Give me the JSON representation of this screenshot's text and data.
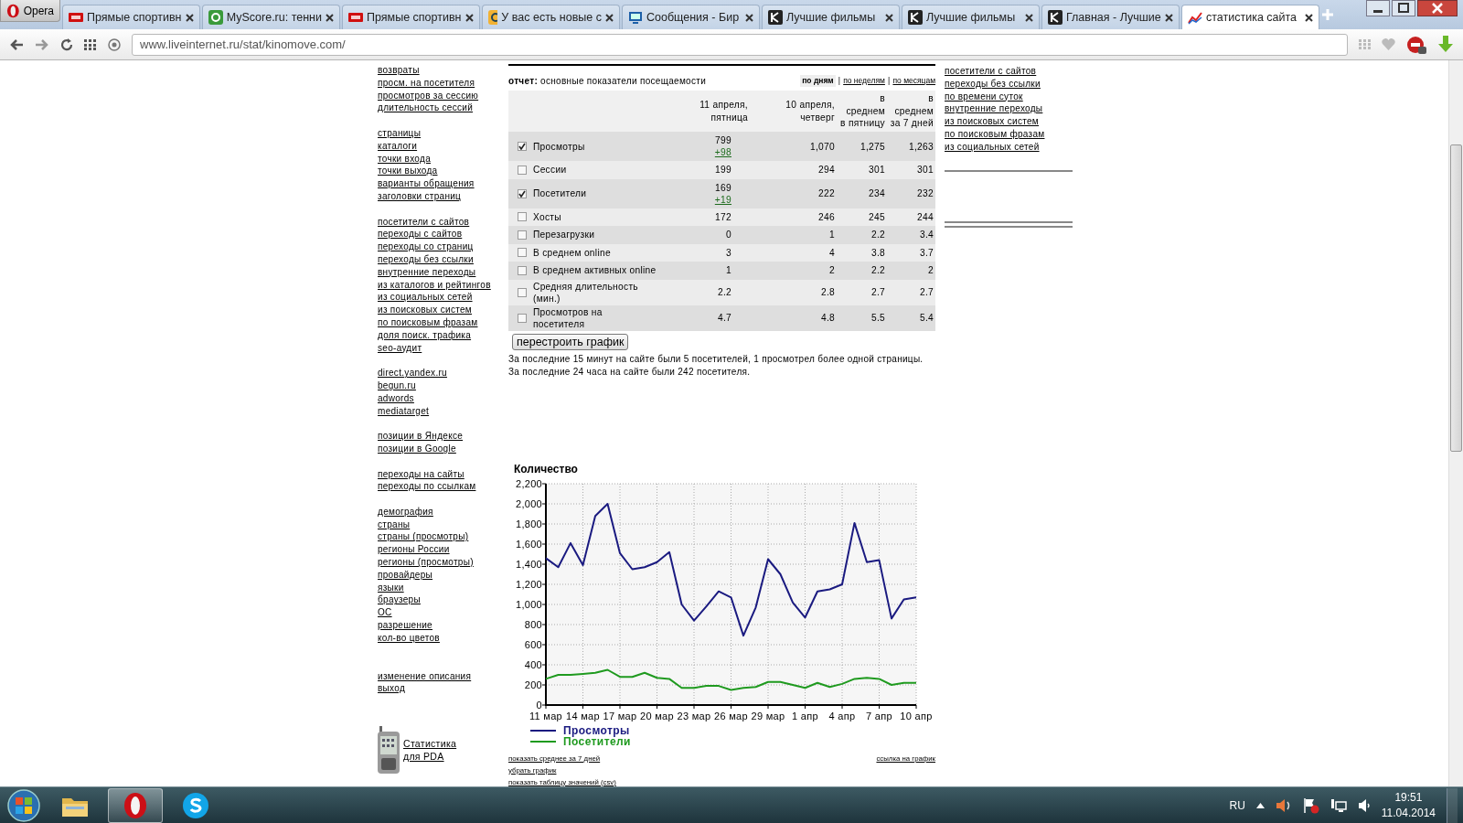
{
  "browser": {
    "menu_label": "Opera",
    "tabs": [
      {
        "label": "Прямые спортивн",
        "selected": false
      },
      {
        "label": "MyScore.ru: тенни",
        "selected": false
      },
      {
        "label": "Прямые спортивн",
        "selected": false
      },
      {
        "label": "У вас есть новые с",
        "selected": false
      },
      {
        "label": "Сообщения - Бир",
        "selected": false
      },
      {
        "label": "Лучшие фильмы",
        "selected": false
      },
      {
        "label": "Лучшие фильмы",
        "selected": false
      },
      {
        "label": "Главная - Лучшие",
        "selected": false
      },
      {
        "label": "статистика сайта",
        "selected": true
      }
    ],
    "address": "www.liveinternet.ru/stat/kinomove.com/"
  },
  "sidebar": {
    "groups": [
      [
        "возвраты",
        "просм. на посетителя",
        "просмотров за сессию",
        "длительность сессий"
      ],
      [
        "страницы",
        "каталоги",
        "точки входа",
        "точки выхода",
        "варианты обращения",
        "заголовки страниц"
      ],
      [
        "посетители с сайтов",
        "переходы с сайтов",
        "переходы со страниц",
        "переходы без ссылки",
        "внутренние переходы",
        "из каталогов и рейтингов",
        "из социальных сетей",
        "из поисковых систем",
        "по поисковым фразам",
        "доля поиск. трафика",
        "seo-аудит"
      ],
      [
        "direct.yandex.ru",
        "begun.ru",
        "adwords",
        "mediatarget"
      ],
      [
        "позиции в Яндексе",
        "позиции в Google"
      ],
      [
        "переходы на сайты",
        "переходы по ссылкам"
      ],
      [
        "демография",
        "страны",
        "страны (просмотры)",
        "регионы России",
        "регионы (просмотры)",
        "провайдеры",
        "языки",
        "браузеры",
        "ОС",
        "разрешение",
        "кол-во цветов"
      ],
      [
        "изменение описания",
        "выход"
      ]
    ],
    "pda_link": "Статистика для PDA"
  },
  "report": {
    "label": "отчет:",
    "title": "основные показатели посещаемости",
    "periods": [
      {
        "label": "по дням",
        "selected": true
      },
      {
        "label": "по неделям",
        "selected": false
      },
      {
        "label": "по месяцам",
        "selected": false
      }
    ],
    "period_separators": [
      "|",
      "|"
    ],
    "columns": [
      "11 апреля, пятница",
      "10 апреля, четверг",
      "в среднем в пятницу",
      "в среднем за 7 дней"
    ],
    "rows": [
      {
        "label": "Просмотры",
        "checked": true,
        "values": [
          "799",
          "1,070",
          "1,275",
          "1,263"
        ],
        "delta": "+98"
      },
      {
        "label": "Сессии",
        "checked": false,
        "values": [
          "199",
          "294",
          "301",
          "301"
        ]
      },
      {
        "label": "Посетители",
        "checked": true,
        "values": [
          "169",
          "222",
          "234",
          "232"
        ],
        "delta": "+19"
      },
      {
        "label": "Хосты",
        "checked": false,
        "values": [
          "172",
          "246",
          "245",
          "244"
        ]
      },
      {
        "label": "Перезагрузки",
        "checked": false,
        "values": [
          "0",
          "1",
          "2.2",
          "3.4"
        ]
      },
      {
        "label": "В среднем online",
        "checked": false,
        "values": [
          "3",
          "4",
          "3.8",
          "3.7"
        ]
      },
      {
        "label": "В среднем активных online",
        "checked": false,
        "values": [
          "1",
          "2",
          "2.2",
          "2"
        ]
      },
      {
        "label": "Средняя длительность (мин.)",
        "checked": false,
        "values": [
          "2.2",
          "2.8",
          "2.7",
          "2.7"
        ]
      },
      {
        "label": "Просмотров на посетителя",
        "checked": false,
        "values": [
          "4.7",
          "4.8",
          "5.5",
          "5.4"
        ]
      }
    ],
    "rebuild_button": "перестроить график",
    "notes": [
      "За последние 15 минут на сайте были 5 посетителей, 1 просмотрел более одной страницы.",
      "За последние 24 часа на сайте были 242 посетителя."
    ]
  },
  "chart": {
    "chart_data": {
      "type": "line",
      "title": "Количество",
      "categories": [
        "11 мар",
        null,
        null,
        "14 мар",
        null,
        null,
        "17 мар",
        null,
        null,
        "20 мар",
        null,
        null,
        "23 мар",
        null,
        null,
        "26 мар",
        null,
        null,
        "29 мар",
        null,
        null,
        "1 апр",
        null,
        null,
        "4 апр",
        null,
        null,
        "7 апр",
        null,
        null,
        "10 апр"
      ],
      "series": [
        {
          "name": "Просмотры",
          "color": "#1a1a80",
          "values": [
            1460,
            1370,
            1610,
            1390,
            1880,
            2000,
            1510,
            1350,
            1370,
            1420,
            1520,
            1000,
            840,
            980,
            1130,
            1070,
            690,
            970,
            1450,
            1300,
            1020,
            870,
            1130,
            1150,
            1200,
            1810,
            1420,
            1440,
            860,
            1050,
            1070
          ]
        },
        {
          "name": "Посетители",
          "color": "#1f9a1f",
          "values": [
            260,
            300,
            300,
            310,
            320,
            350,
            280,
            280,
            320,
            270,
            260,
            170,
            170,
            190,
            190,
            150,
            170,
            180,
            230,
            230,
            200,
            170,
            220,
            180,
            210,
            260,
            270,
            260,
            200,
            220,
            220
          ]
        }
      ],
      "ylim": [
        0,
        2200
      ],
      "grid": true,
      "yticks": [
        0,
        200,
        400,
        600,
        800,
        {
          "value": 1000,
          "label": "1,000"
        },
        {
          "value": 1200,
          "label": "1,200"
        },
        {
          "value": 1400,
          "label": "1,400"
        },
        {
          "value": 1600,
          "label": "1,600"
        },
        {
          "value": 1800,
          "label": "1,800"
        },
        {
          "value": 2000,
          "label": "2,000"
        },
        {
          "value": 2200,
          "label": "2,200"
        }
      ]
    },
    "links_left": [
      "показать среднее за 7 дней",
      "убрать график",
      "показать таблицу значений (csv)"
    ],
    "link_right": "ссылка на график"
  },
  "right_links": [
    "посетители с сайтов",
    "переходы без ссылки",
    "по времени суток",
    "внутренние переходы",
    "из поисковых систем",
    "по поисковым фразам",
    "из социальных сетей"
  ],
  "taskbar": {
    "apps": [
      {
        "kind": "explorer",
        "selected": false
      },
      {
        "kind": "opera",
        "selected": true
      },
      {
        "kind": "skype",
        "selected": false
      }
    ],
    "language": "RU",
    "time": "19:51",
    "date": "11.04.2014"
  }
}
